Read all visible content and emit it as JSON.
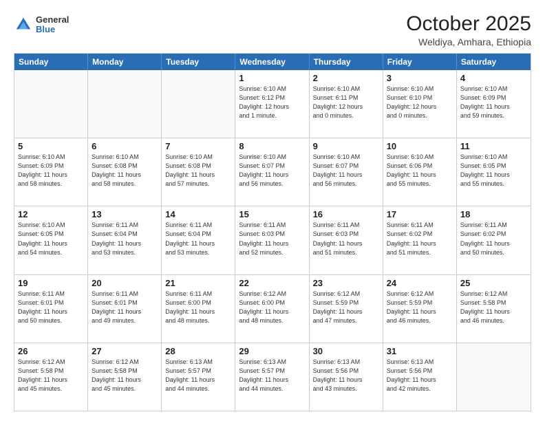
{
  "header": {
    "logo_general": "General",
    "logo_blue": "Blue",
    "title": "October 2025",
    "subtitle": "Weldiya, Amhara, Ethiopia"
  },
  "calendar": {
    "weekdays": [
      "Sunday",
      "Monday",
      "Tuesday",
      "Wednesday",
      "Thursday",
      "Friday",
      "Saturday"
    ],
    "weeks": [
      [
        {
          "day": "",
          "info": ""
        },
        {
          "day": "",
          "info": ""
        },
        {
          "day": "",
          "info": ""
        },
        {
          "day": "1",
          "info": "Sunrise: 6:10 AM\nSunset: 6:12 PM\nDaylight: 12 hours\nand 1 minute."
        },
        {
          "day": "2",
          "info": "Sunrise: 6:10 AM\nSunset: 6:11 PM\nDaylight: 12 hours\nand 0 minutes."
        },
        {
          "day": "3",
          "info": "Sunrise: 6:10 AM\nSunset: 6:10 PM\nDaylight: 12 hours\nand 0 minutes."
        },
        {
          "day": "4",
          "info": "Sunrise: 6:10 AM\nSunset: 6:09 PM\nDaylight: 11 hours\nand 59 minutes."
        }
      ],
      [
        {
          "day": "5",
          "info": "Sunrise: 6:10 AM\nSunset: 6:09 PM\nDaylight: 11 hours\nand 58 minutes."
        },
        {
          "day": "6",
          "info": "Sunrise: 6:10 AM\nSunset: 6:08 PM\nDaylight: 11 hours\nand 58 minutes."
        },
        {
          "day": "7",
          "info": "Sunrise: 6:10 AM\nSunset: 6:08 PM\nDaylight: 11 hours\nand 57 minutes."
        },
        {
          "day": "8",
          "info": "Sunrise: 6:10 AM\nSunset: 6:07 PM\nDaylight: 11 hours\nand 56 minutes."
        },
        {
          "day": "9",
          "info": "Sunrise: 6:10 AM\nSunset: 6:07 PM\nDaylight: 11 hours\nand 56 minutes."
        },
        {
          "day": "10",
          "info": "Sunrise: 6:10 AM\nSunset: 6:06 PM\nDaylight: 11 hours\nand 55 minutes."
        },
        {
          "day": "11",
          "info": "Sunrise: 6:10 AM\nSunset: 6:05 PM\nDaylight: 11 hours\nand 55 minutes."
        }
      ],
      [
        {
          "day": "12",
          "info": "Sunrise: 6:10 AM\nSunset: 6:05 PM\nDaylight: 11 hours\nand 54 minutes."
        },
        {
          "day": "13",
          "info": "Sunrise: 6:11 AM\nSunset: 6:04 PM\nDaylight: 11 hours\nand 53 minutes."
        },
        {
          "day": "14",
          "info": "Sunrise: 6:11 AM\nSunset: 6:04 PM\nDaylight: 11 hours\nand 53 minutes."
        },
        {
          "day": "15",
          "info": "Sunrise: 6:11 AM\nSunset: 6:03 PM\nDaylight: 11 hours\nand 52 minutes."
        },
        {
          "day": "16",
          "info": "Sunrise: 6:11 AM\nSunset: 6:03 PM\nDaylight: 11 hours\nand 51 minutes."
        },
        {
          "day": "17",
          "info": "Sunrise: 6:11 AM\nSunset: 6:02 PM\nDaylight: 11 hours\nand 51 minutes."
        },
        {
          "day": "18",
          "info": "Sunrise: 6:11 AM\nSunset: 6:02 PM\nDaylight: 11 hours\nand 50 minutes."
        }
      ],
      [
        {
          "day": "19",
          "info": "Sunrise: 6:11 AM\nSunset: 6:01 PM\nDaylight: 11 hours\nand 50 minutes."
        },
        {
          "day": "20",
          "info": "Sunrise: 6:11 AM\nSunset: 6:01 PM\nDaylight: 11 hours\nand 49 minutes."
        },
        {
          "day": "21",
          "info": "Sunrise: 6:11 AM\nSunset: 6:00 PM\nDaylight: 11 hours\nand 48 minutes."
        },
        {
          "day": "22",
          "info": "Sunrise: 6:12 AM\nSunset: 6:00 PM\nDaylight: 11 hours\nand 48 minutes."
        },
        {
          "day": "23",
          "info": "Sunrise: 6:12 AM\nSunset: 5:59 PM\nDaylight: 11 hours\nand 47 minutes."
        },
        {
          "day": "24",
          "info": "Sunrise: 6:12 AM\nSunset: 5:59 PM\nDaylight: 11 hours\nand 46 minutes."
        },
        {
          "day": "25",
          "info": "Sunrise: 6:12 AM\nSunset: 5:58 PM\nDaylight: 11 hours\nand 46 minutes."
        }
      ],
      [
        {
          "day": "26",
          "info": "Sunrise: 6:12 AM\nSunset: 5:58 PM\nDaylight: 11 hours\nand 45 minutes."
        },
        {
          "day": "27",
          "info": "Sunrise: 6:12 AM\nSunset: 5:58 PM\nDaylight: 11 hours\nand 45 minutes."
        },
        {
          "day": "28",
          "info": "Sunrise: 6:13 AM\nSunset: 5:57 PM\nDaylight: 11 hours\nand 44 minutes."
        },
        {
          "day": "29",
          "info": "Sunrise: 6:13 AM\nSunset: 5:57 PM\nDaylight: 11 hours\nand 44 minutes."
        },
        {
          "day": "30",
          "info": "Sunrise: 6:13 AM\nSunset: 5:56 PM\nDaylight: 11 hours\nand 43 minutes."
        },
        {
          "day": "31",
          "info": "Sunrise: 6:13 AM\nSunset: 5:56 PM\nDaylight: 11 hours\nand 42 minutes."
        },
        {
          "day": "",
          "info": ""
        }
      ]
    ]
  }
}
